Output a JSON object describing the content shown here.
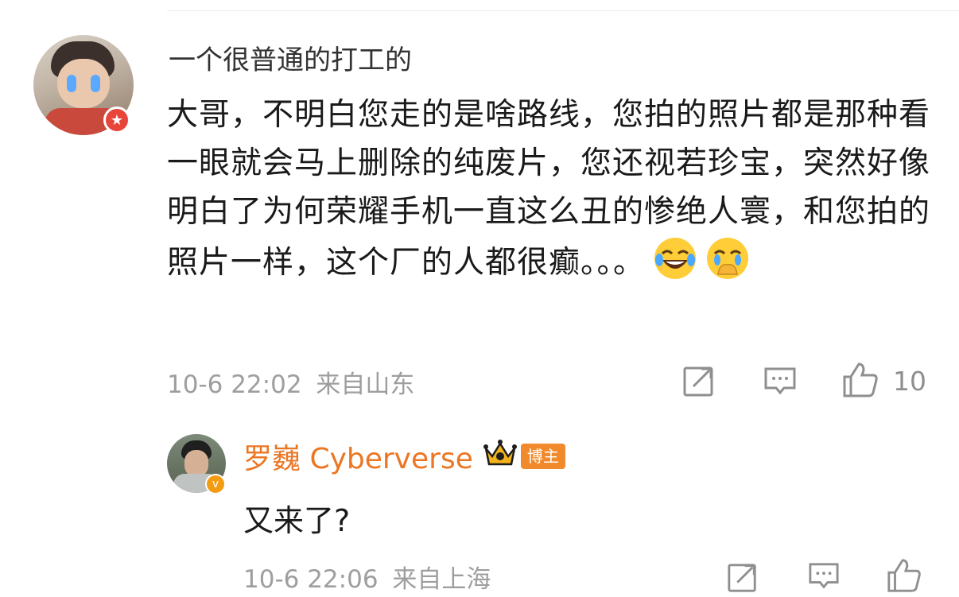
{
  "comment": {
    "username": "一个很普通的打工的",
    "text": "大哥，不明白您走的是啥路线，您拍的照片都是那种看一眼就会马上删除的纯废片，您还视若珍宝，突然好像明白了为何荣耀手机一直这么丑的惨绝人寰，和您拍的照片一样，这个厂的人都很癫。。。",
    "emojis": [
      "laugh-cry-emoji",
      "cover-mouth-tears-emoji"
    ],
    "timestamp": "10-6 22:02",
    "location": "来自山东",
    "like_count": "10",
    "avatar_badge_icon": "star-icon"
  },
  "reply": {
    "username": "罗巍 Cyberverse",
    "role_badge": "博主",
    "text": "又来了?",
    "timestamp": "10-6 22:06",
    "location": "来自上海",
    "avatar_badge_icon": "verified-v-icon"
  },
  "colors": {
    "reply_name": "#eb7623",
    "meta_text": "#9e9e9e",
    "badge_red": "#e8463b",
    "badge_orange": "#f39c12"
  }
}
